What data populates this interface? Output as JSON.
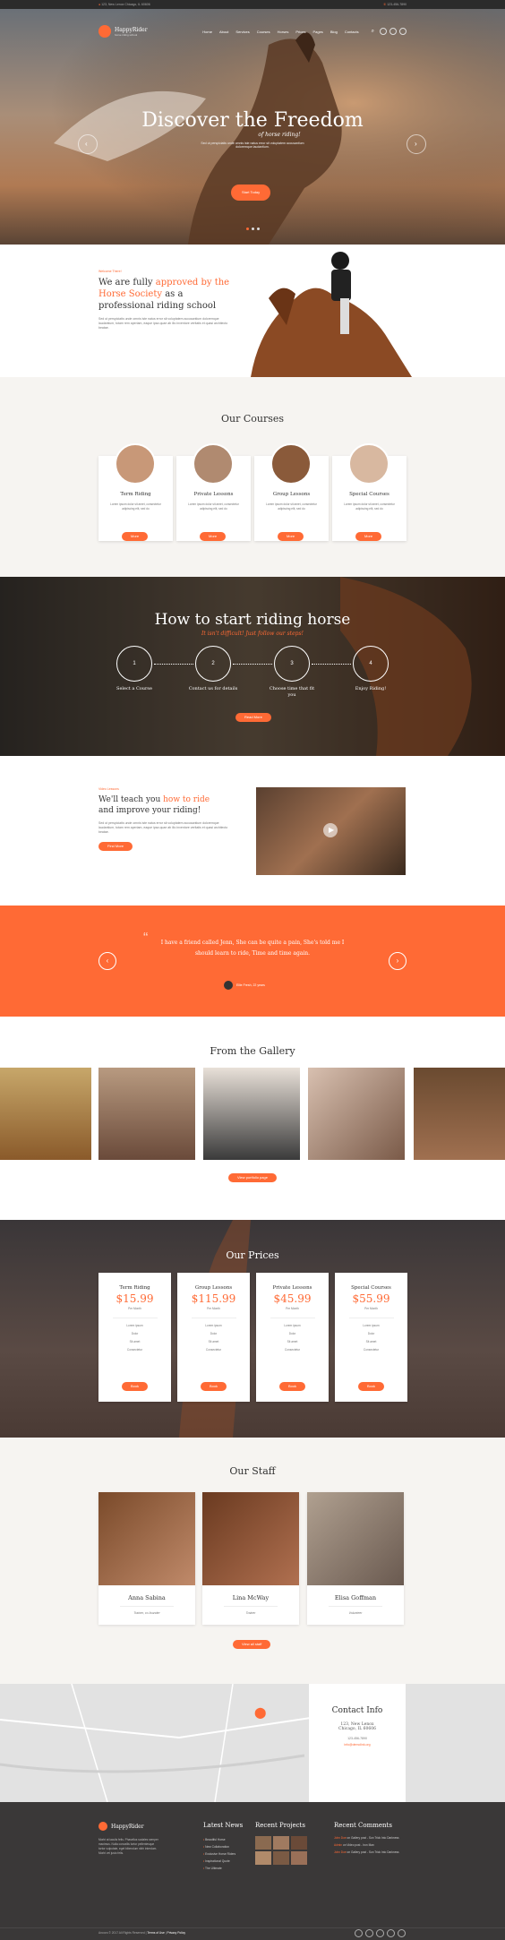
{
  "topbar": {
    "address": "123, New Lenox Chicago, IL 60606",
    "phone": "123-456-7890"
  },
  "brand": {
    "name": "HappyRider",
    "tagline": "horse riding school"
  },
  "nav": {
    "items": [
      "Home",
      "About",
      "Services",
      "Courses",
      "Horses",
      "Prices",
      "Pages",
      "Blog",
      "Contacts"
    ]
  },
  "hero": {
    "title": "Discover the Freedom",
    "subtitle": "of horse riding!",
    "text": "Sed ut perspiciatis unde omnis iste natus error sit voluptatem accusantium doloremque laudantium.",
    "button": "Start Today"
  },
  "welcome": {
    "eyebrow": "Welcome There!",
    "title_pre": "We are fully ",
    "title_highlight": "approved by the Horse Society",
    "title_post": " as a professional riding school",
    "text": "Sed ut perspiciatis unde omnis iste natus error sit voluptatem accusantium doloremque laudantium, totam rem aperiam, eaque ipsa quae ab illo inventore veritatis et quasi architecto beatae."
  },
  "courses": {
    "title": "Our Courses",
    "items": [
      {
        "name": "Term Riding",
        "text": "Lorem ipsum dolor sit amet, consectetur adipiscing elit, sed do",
        "button": "More"
      },
      {
        "name": "Private Lessons",
        "text": "Lorem ipsum dolor sit amet, consectetur adipiscing elit, sed do",
        "button": "More"
      },
      {
        "name": "Group Lessons",
        "text": "Lorem ipsum dolor sit amet, consectetur adipiscing elit, sed do",
        "button": "More"
      },
      {
        "name": "Special Courses",
        "text": "Lorem ipsum dolor sit amet, consectetur adipiscing elit, sed do",
        "button": "More"
      }
    ]
  },
  "howto": {
    "title": "How to start riding horse",
    "subtitle": "It isn't difficult! Just follow our steps!",
    "steps": [
      {
        "num": "1",
        "label": "Select a Course"
      },
      {
        "num": "2",
        "label": "Contact us for details"
      },
      {
        "num": "3",
        "label": "Choose time that fit you"
      },
      {
        "num": "4",
        "label": "Enjoy Riding!"
      }
    ],
    "button": "Read More"
  },
  "teach": {
    "eyebrow": "Video Lessons",
    "title_pre": "We'll teach you ",
    "title_highlight": "how to ride",
    "title_post": "and improve your riding!",
    "text": "Sed ut perspiciatis unde omnis iste natus error sit voluptatem accusantium doloremque laudantium, totam rem aperiam, eaque ipsa quae ab illo inventore veritatis et quasi architecto beatae.",
    "button": "Find More"
  },
  "testimonial": {
    "quote": "I have a friend called Jenn, She can be quite a pain, She's told me I should learn to ride, Time and time again.",
    "author": "Ellie Fresh, 22 years"
  },
  "gallery": {
    "title": "From the Gallery",
    "button": "View portfolio page"
  },
  "prices": {
    "title": "Our Prices",
    "items": [
      {
        "name": "Term Riding",
        "price": "$15.99",
        "period": "Per Month",
        "features": [
          "Lorem ipsum",
          "Dolor",
          "Sit amet",
          "Consectetur"
        ],
        "button": "Book"
      },
      {
        "name": "Group Lessons",
        "price": "$115.99",
        "period": "Per Month",
        "features": [
          "Lorem ipsum",
          "Dolor",
          "Sit amet",
          "Consectetur"
        ],
        "button": "Book"
      },
      {
        "name": "Private Lessons",
        "price": "$45.99",
        "period": "Per Month",
        "features": [
          "Lorem ipsum",
          "Dolor",
          "Sit amet",
          "Consectetur"
        ],
        "button": "Book"
      },
      {
        "name": "Special Courses",
        "price": "$55.99",
        "period": "Per Month",
        "features": [
          "Lorem ipsum",
          "Dolor",
          "Sit amet",
          "Consectetur"
        ],
        "button": "Book"
      }
    ]
  },
  "staff": {
    "title": "Our Staff",
    "items": [
      {
        "name": "Anna Sabina",
        "role": "Trainer, co-founder"
      },
      {
        "name": "Lina McWay",
        "role": "Trainer"
      },
      {
        "name": "Elisa Goffman",
        "role": "Volunteer"
      }
    ],
    "button": "View all staff"
  },
  "contact": {
    "title": "Contact Info",
    "address1": "123, New Lenox",
    "address2": "Chicago, IL 60606",
    "phone": "123-456-7890",
    "email": "info@demolink.org"
  },
  "footer": {
    "about": "Morbi at iaculis felis. Phasellus sodales semper maximus. Nulla convallis tortor pellentesque tortor vulputate, eget bibendum nibh interdum. Morbi vel justo felis.",
    "news_title": "Latest News",
    "news": [
      "Beautiful Horse",
      "New Collaboration",
      "Exclusive Horse Riders",
      "Inspirational Quote",
      "The Ultimate"
    ],
    "projects_title": "Recent Projects",
    "comments_title": "Recent Comments",
    "comments": [
      {
        "who": "John Doe",
        "on": "on Gallery post - Sun Trick Into Darkness"
      },
      {
        "who": "Admin",
        "on": "on Video post - Iron Man"
      },
      {
        "who": "John Doe",
        "on": "on Gallery post - Sun Trick Into Darkness"
      }
    ],
    "copyright": "Ancora © 2017 All Rights Reserved",
    "terms": "Terms of Use",
    "privacy": "Privacy Policy"
  },
  "colors": {
    "accent": "#ff6a35",
    "dark": "#3a3a3a"
  }
}
